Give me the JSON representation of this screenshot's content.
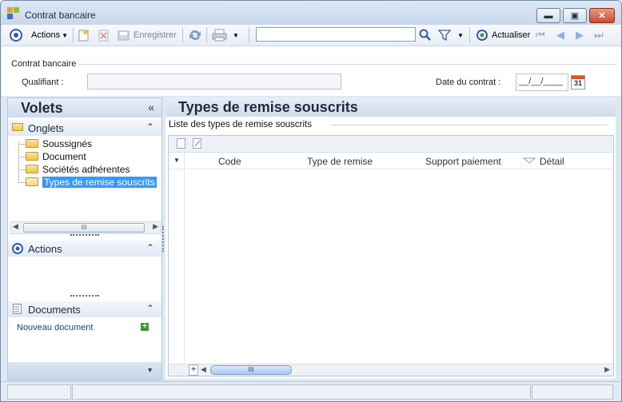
{
  "window": {
    "title": "Contrat bancaire"
  },
  "toolbar": {
    "actions_label": "Actions",
    "save_label": "Enregistrer",
    "search_value": "",
    "refresh_label": "Actualiser"
  },
  "header": {
    "group_title": "Contrat bancaire",
    "qualifiant_label": "Qualifiant :",
    "qualifiant_value": "",
    "date_label": "Date du contrat :",
    "date_value": "__/__/____"
  },
  "sidebar": {
    "title": "Volets",
    "onglets_title": "Onglets",
    "items": [
      {
        "label": "Soussignés"
      },
      {
        "label": "Document"
      },
      {
        "label": "Sociétés adhérentes"
      },
      {
        "label": "Types de remise souscrits"
      }
    ],
    "scroll_grip": "III",
    "actions_title": "Actions",
    "documents_title": "Documents",
    "new_document_link": "Nouveau document"
  },
  "main": {
    "title": "Types de remise souscrits",
    "list_title": "Liste des types de remise souscrits",
    "columns": [
      "Code",
      "Type de remise",
      "Support paiement",
      "Détail"
    ],
    "rows": [],
    "scroll_grip": "III"
  },
  "colors": {
    "accent": "#2f5fa8",
    "selected_item": "#3399ff",
    "link": "#1a3f8f"
  }
}
